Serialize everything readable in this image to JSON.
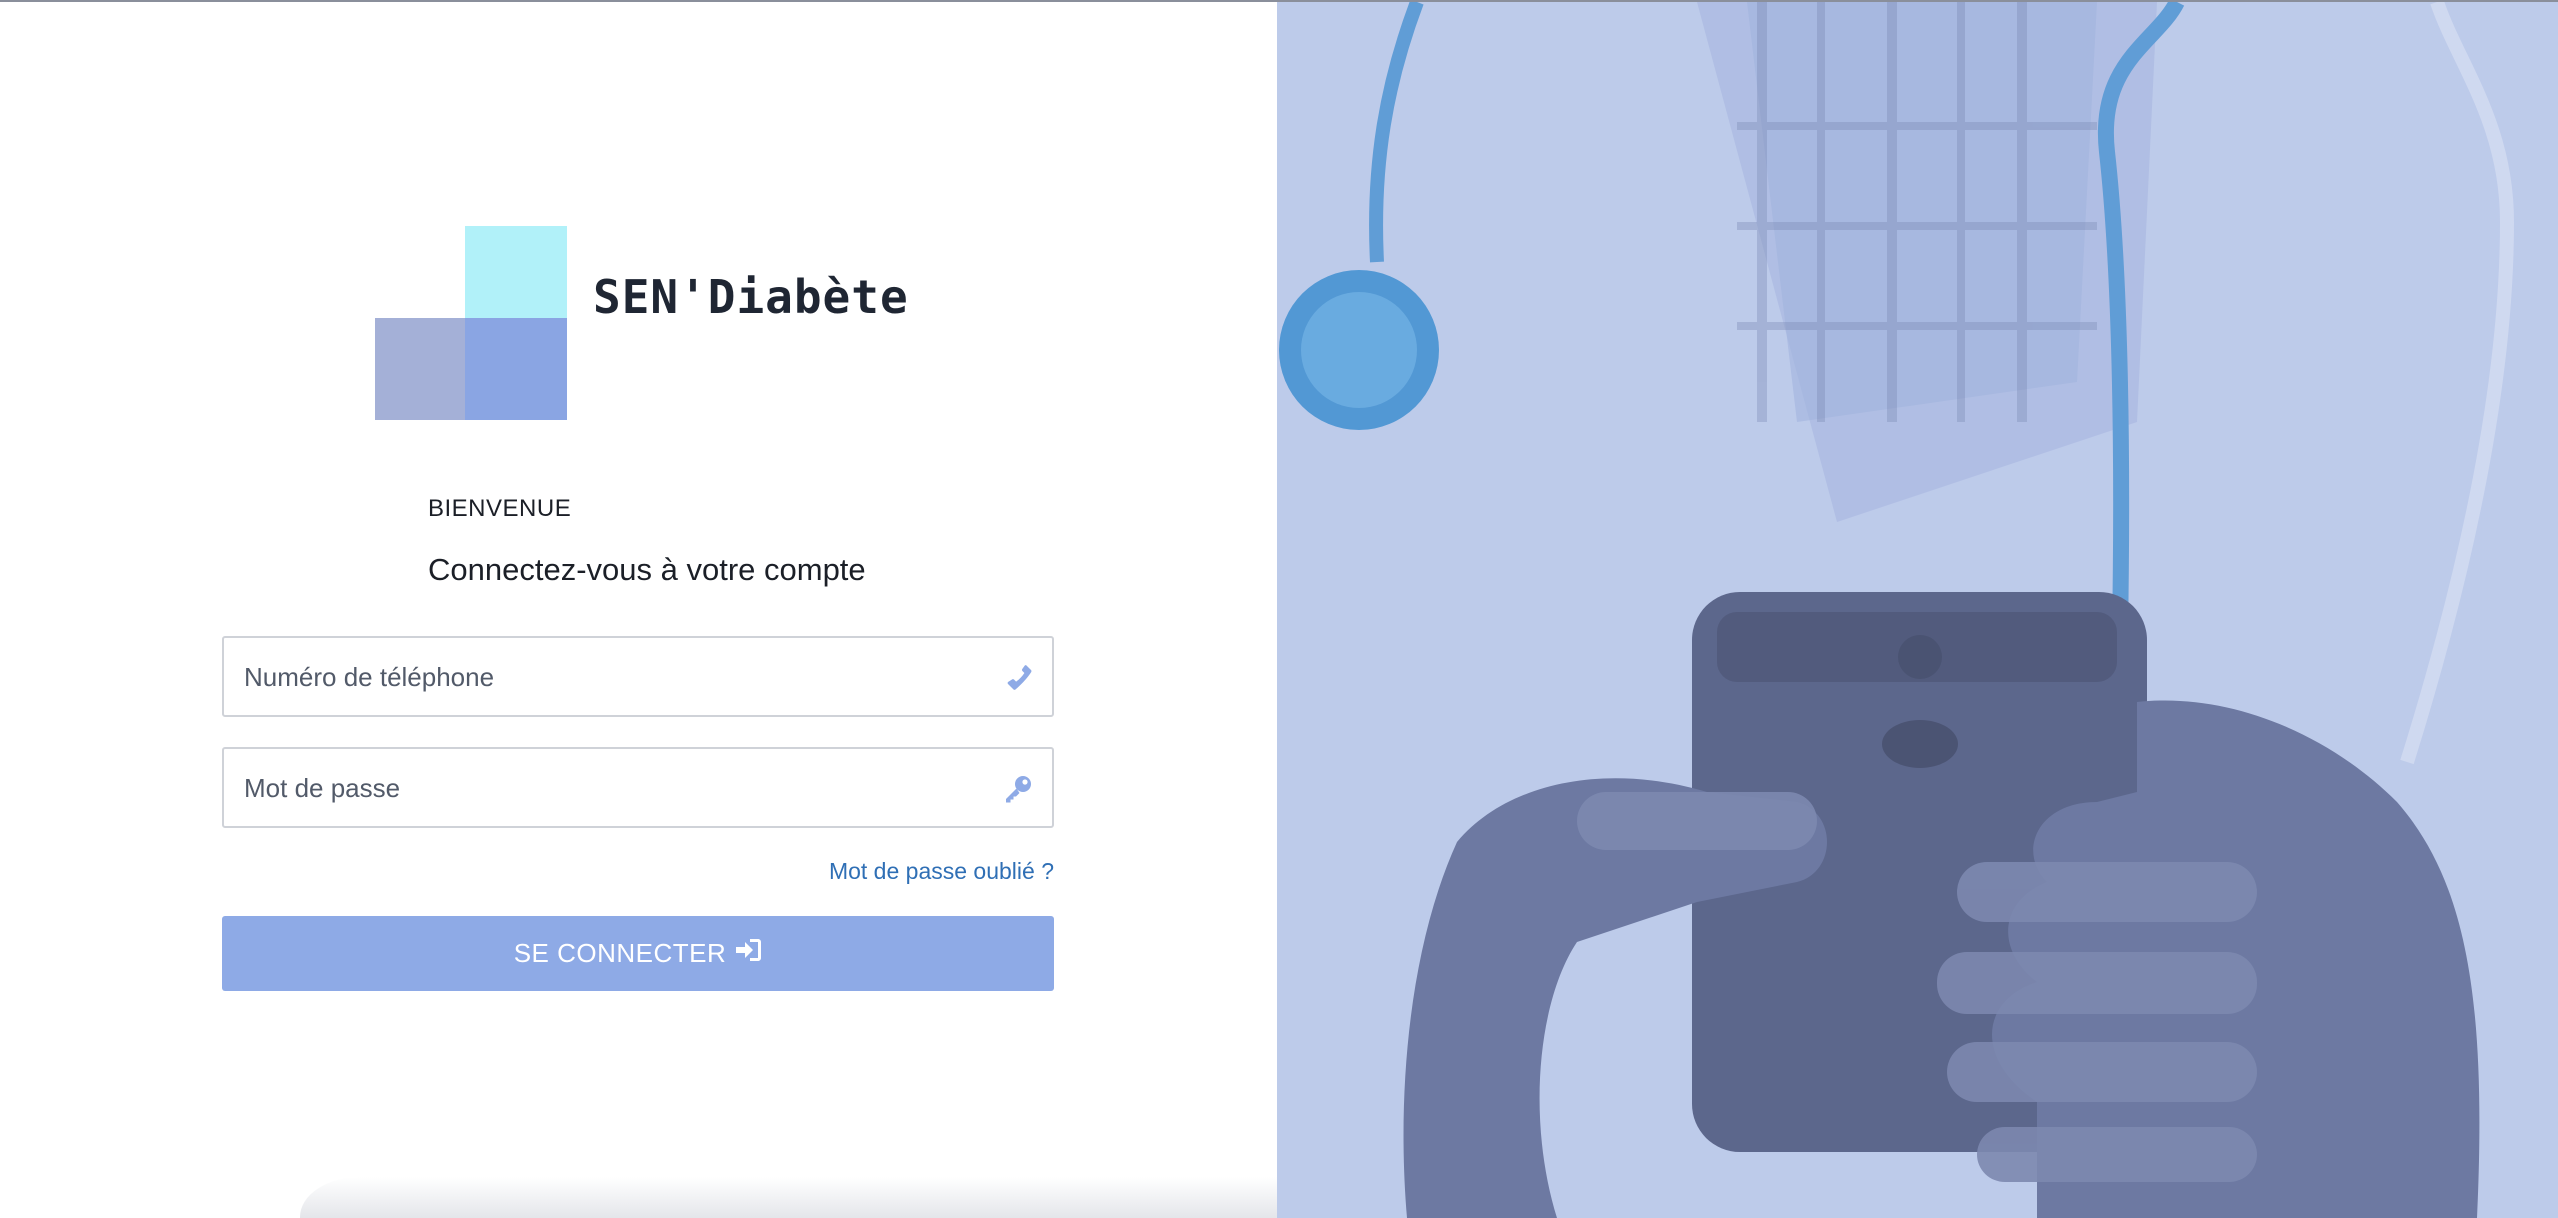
{
  "brand": {
    "name": "SEN'Diabète",
    "colors": {
      "logo_top": "#b1f1f9",
      "logo_left": "#a4b0d7",
      "logo_right": "#8aa5e3"
    }
  },
  "login": {
    "welcome": "BIENVENUE",
    "subtitle": "Connectez-vous à votre compte",
    "phone": {
      "placeholder": "Numéro de téléphone",
      "value": "",
      "icon": "phone-icon"
    },
    "password": {
      "placeholder": "Mot de passe",
      "value": "",
      "icon": "key-icon"
    },
    "forgot_label": "Mot de passe oublié ?",
    "submit_label": "SE CONNECTER",
    "submit_icon": "sign-in-icon",
    "accent_color": "#8eaae6",
    "link_color": "#2f6fb5"
  },
  "hero": {
    "description_icon": "doctor-holding-phone-image",
    "tint_color": "#b9c7e8"
  }
}
